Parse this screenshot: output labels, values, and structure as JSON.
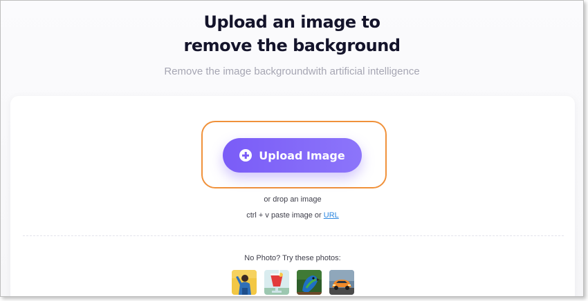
{
  "header": {
    "title_line1": "Upload an image to",
    "title_line2": "remove the background",
    "subtitle": "Remove the image backgroundwith artificial intelligence"
  },
  "upload": {
    "button_label": "Upload Image",
    "button_icon": "plus-circle-icon",
    "drop_text": "or drop an image",
    "paste_text": "ctrl + v paste image or",
    "url_link": "URL"
  },
  "samples": {
    "prompt": "No Photo? Try these photos:",
    "items": [
      {
        "icon": "person-photo-icon"
      },
      {
        "icon": "drink-photo-icon"
      },
      {
        "icon": "parrot-photo-icon"
      },
      {
        "icon": "car-photo-icon"
      }
    ]
  },
  "colors": {
    "accent": "#7a5cf7",
    "highlight_outline": "#f0913a",
    "link": "#2b86e0",
    "title": "#14142b",
    "subtitle": "#a6a6b3"
  }
}
